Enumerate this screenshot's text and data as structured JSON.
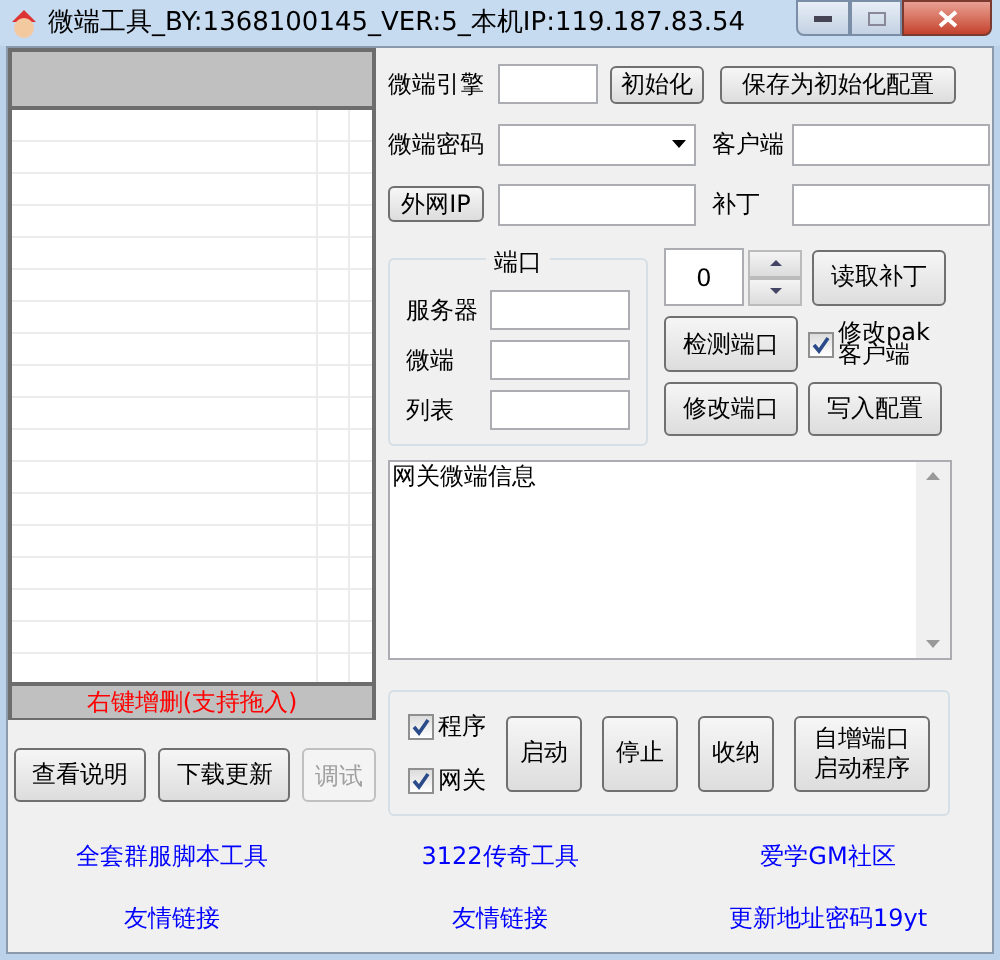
{
  "window": {
    "title": "微端工具_BY:1368100145_VER:5_本机IP:119.187.83.54"
  },
  "list_footer": "右键增删(支持拖入)",
  "left_buttons": [
    {
      "label": "查看说明",
      "disabled": false
    },
    {
      "label": "下载更新",
      "disabled": false
    },
    {
      "label": "调试",
      "disabled": true
    }
  ],
  "engine": {
    "label": "微端引擎",
    "init_button": "初始化",
    "save_button": "保存为初始化配置"
  },
  "password": {
    "label": "微端密码"
  },
  "client": {
    "label": "客户端"
  },
  "external_ip": {
    "button": "外网IP"
  },
  "patch": {
    "label": "补丁"
  },
  "port_group": {
    "title": "端口",
    "fields": [
      {
        "label": "服务器"
      },
      {
        "label": "微端"
      },
      {
        "label": "列表"
      }
    ]
  },
  "spinner": {
    "value": "0"
  },
  "port_buttons": {
    "read_patch": "读取补丁",
    "check_port": "检测端口",
    "modify_port": "修改端口",
    "write_config": "写入配置"
  },
  "modify_pak": {
    "label": "修改pak客户端",
    "checked": true
  },
  "info_box": {
    "value": "网关微端信息"
  },
  "run_options": [
    {
      "label": "程序",
      "checked": true
    },
    {
      "label": "网关",
      "checked": true
    }
  ],
  "run_buttons": [
    "启动",
    "停止",
    "收纳",
    "自增端口启动程序"
  ],
  "links": [
    [
      "全套群服脚本工具",
      "3122传奇工具",
      "爱学GM社区"
    ],
    [
      "友情链接",
      "友情链接",
      "更新地址密码19yt"
    ]
  ]
}
